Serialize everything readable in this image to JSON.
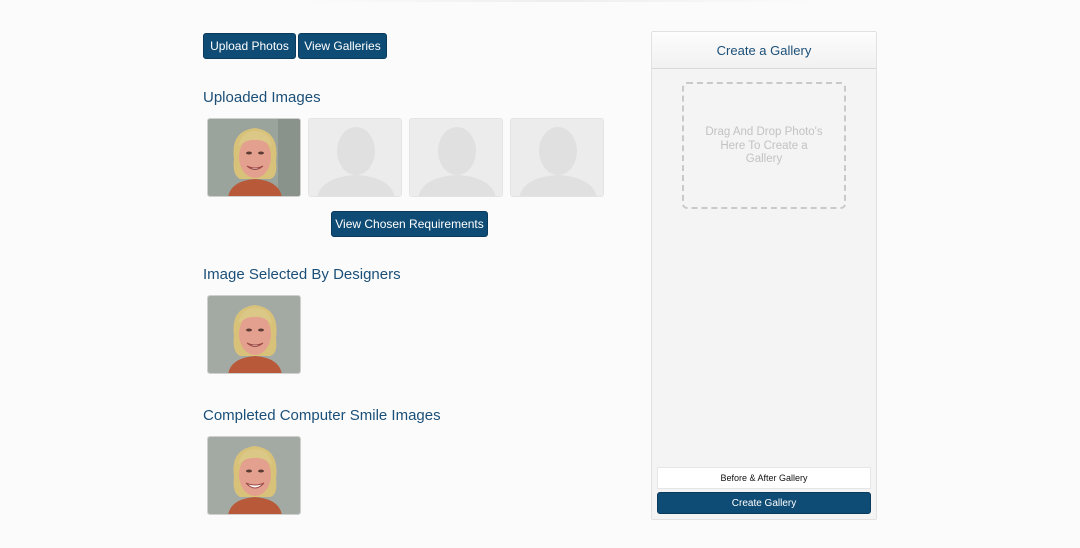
{
  "toolbar": {
    "upload_label": "Upload Photos",
    "galleries_label": "View Galleries"
  },
  "uploaded": {
    "heading": "Uploaded Images",
    "items": [
      "photo",
      "placeholder",
      "placeholder",
      "placeholder"
    ]
  },
  "requirements_button": "View Chosen Requirements",
  "selected": {
    "heading": "Image Selected By Designers"
  },
  "completed": {
    "heading": "Completed Computer Smile Images"
  },
  "panel": {
    "title": "Create a Gallery",
    "dropzone_text": "Drag And Drop Photo's Here To Create a Gallery",
    "gallery_name_value": "Before & After Gallery",
    "create_label": "Create Gallery"
  },
  "colors": {
    "accent": "#0f4c75",
    "heading": "#1b4f78",
    "placeholder": "#ececec"
  },
  "icons": {
    "portrait_placeholder": "person-silhouette-icon"
  }
}
